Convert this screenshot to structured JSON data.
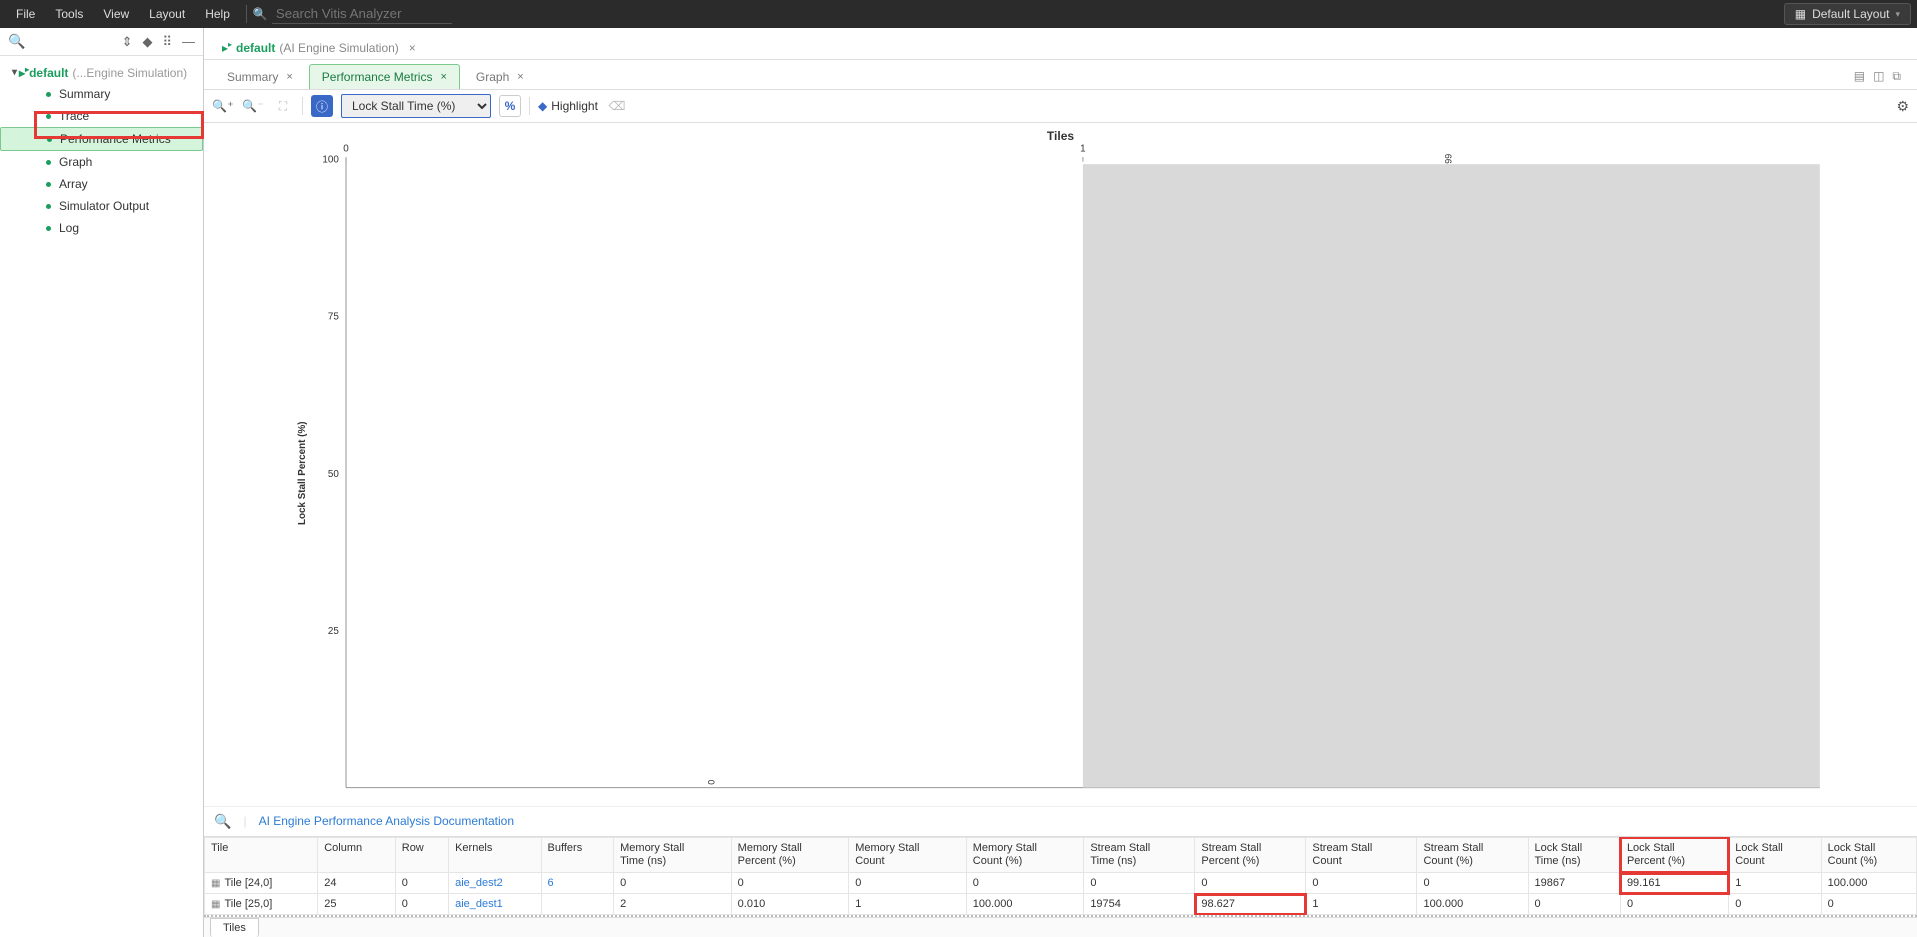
{
  "menu": {
    "file": "File",
    "tools": "Tools",
    "view": "View",
    "layout": "Layout",
    "help": "Help"
  },
  "search_placeholder": "Search Vitis Analyzer",
  "default_layout": "Default Layout",
  "sidebar": {
    "run_name": "default",
    "run_suffix": "(...Engine Simulation)",
    "items": [
      "Summary",
      "Trace",
      "Performance Metrics",
      "Graph",
      "Array",
      "Simulator Output",
      "Log"
    ],
    "selected": 2
  },
  "doc_tab": {
    "name": "default",
    "suffix": "(AI Engine Simulation)"
  },
  "inner_tabs": [
    {
      "label": "Summary"
    },
    {
      "label": "Performance Metrics"
    },
    {
      "label": "Graph"
    }
  ],
  "metric_dropdown": "Lock Stall Time (%)",
  "highlight_label": "Highlight",
  "chart_data": {
    "type": "bar",
    "title": "Tiles",
    "xlabel": "",
    "ylabel": "Lock Stall Percent (%)",
    "categories": [
      "0",
      "1"
    ],
    "x_ticks": [
      "0",
      "1"
    ],
    "y_ticks": [
      "25",
      "50",
      "75",
      "100"
    ],
    "values": [
      0,
      99.161
    ],
    "ylim": [
      0,
      100
    ],
    "bar_labels": [
      "0",
      "99"
    ]
  },
  "docs_link": "AI Engine Performance Analysis Documentation",
  "table": {
    "headers": [
      "Tile",
      "Column",
      "Row",
      "Kernels",
      "Buffers",
      "Memory Stall Time (ns)",
      "Memory Stall Percent (%)",
      "Memory Stall Count",
      "Memory Stall Count (%)",
      "Stream Stall Time (ns)",
      "Stream Stall Percent (%)",
      "Stream Stall Count",
      "Stream Stall Count (%)",
      "Lock Stall Time (ns)",
      "Lock Stall Percent (%)",
      "Lock Stall Count",
      "Lock Stall Count (%)"
    ],
    "rows": [
      {
        "tile": "Tile [24,0]",
        "col": "24",
        "row": "0",
        "kernels": "aie_dest2",
        "buffers": "6",
        "mst": "0",
        "msp": "0",
        "msc": "0",
        "mscp": "0",
        "sst": "0",
        "ssp": "0",
        "ssc": "0",
        "sscp": "0",
        "lst": "19867",
        "lsp": "99.161",
        "lsc": "1",
        "lscp": "100.000"
      },
      {
        "tile": "Tile [25,0]",
        "col": "25",
        "row": "0",
        "kernels": "aie_dest1",
        "buffers": "",
        "mst": "2",
        "msp": "0.010",
        "msc": "1",
        "mscp": "100.000",
        "sst": "19754",
        "ssp": "98.627",
        "ssc": "1",
        "sscp": "100.000",
        "lst": "0",
        "lsp": "0",
        "lsc": "0",
        "lscp": "0"
      }
    ]
  },
  "bottom_tab": "Tiles",
  "pct_symbol": "%"
}
